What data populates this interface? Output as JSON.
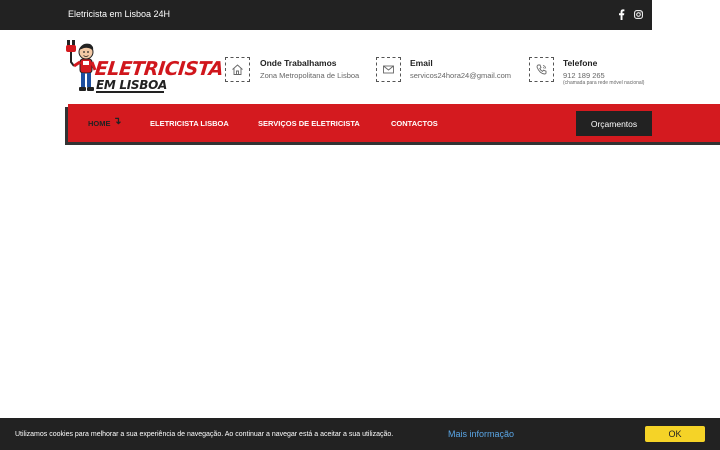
{
  "topbar": {
    "title": "Eletricista em Lisboa 24H",
    "icons": [
      "facebook-icon",
      "instagram-icon"
    ]
  },
  "logo": {
    "line1": "ELETRICISTA",
    "line2": "EM LISBOA"
  },
  "info": [
    {
      "icon": "home-icon",
      "title": "Onde Trabalhamos",
      "value": "Zona Metropolitana de Lisboa"
    },
    {
      "icon": "envelope-icon",
      "title": "Email",
      "value": "servicos24hora24@gmail.com"
    },
    {
      "icon": "phone-icon",
      "title": "Telefone",
      "value": "912 189 265",
      "note": "(chamada para rede móvel nacional)"
    }
  ],
  "nav": {
    "items": [
      {
        "label": "HOME",
        "active": true
      },
      {
        "label": "ELETRICISTA LISBOA"
      },
      {
        "label": "SERVIÇOS DE ELETRICISTA"
      },
      {
        "label": "CONTACTOS"
      }
    ],
    "quote_button": "Orçamentos"
  },
  "cookie": {
    "text": "Utilizamos cookies para melhorar a sua experiência de navegação. Ao continuar a navegar está a aceitar a sua utilização.",
    "link": "Mais informação",
    "ok": "OK"
  },
  "colors": {
    "brand_red": "#d41a1f",
    "dark": "#222222",
    "cookie_button": "#f5d327",
    "link_blue": "#5aa6e6"
  }
}
